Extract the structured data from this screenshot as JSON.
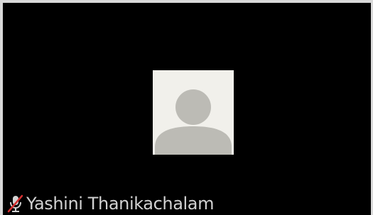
{
  "participant": {
    "name": "Yashini Thanikachalam",
    "muted": true
  },
  "icons": {
    "avatar": "default-avatar-icon",
    "mic": "mic-muted-icon"
  },
  "colors": {
    "background": "#000000",
    "tile_border": "#d9d9d9",
    "avatar_bg": "#f1f0eb",
    "avatar_silhouette": "#bcbbb5",
    "name_text": "#d2d2d2",
    "mute_slash": "#d42f2f"
  }
}
